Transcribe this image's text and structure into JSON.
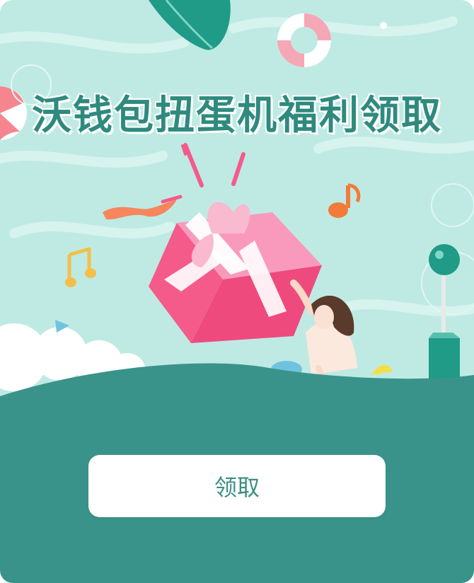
{
  "page": {
    "title": "沃钱包扭蛋机福利领取",
    "claim_button_label": "领取"
  },
  "colors": {
    "background": "#bfeae3",
    "hill": "#3a938a",
    "title_text": "#2f8a7e",
    "button_bg": "#ffffff",
    "button_text": "#3a8f83",
    "gift_box": "#f45b8a",
    "ribbon": "#f9b9cf"
  },
  "icons": {
    "top_float": "swim-ring-icon",
    "left_decor": "beach-ball-icon",
    "note_left": "music-note-icon",
    "note_right": "music-note-icon",
    "gift": "gift-box-icon",
    "lever": "gacha-lever-icon",
    "leaf": "palm-leaf-icon"
  }
}
